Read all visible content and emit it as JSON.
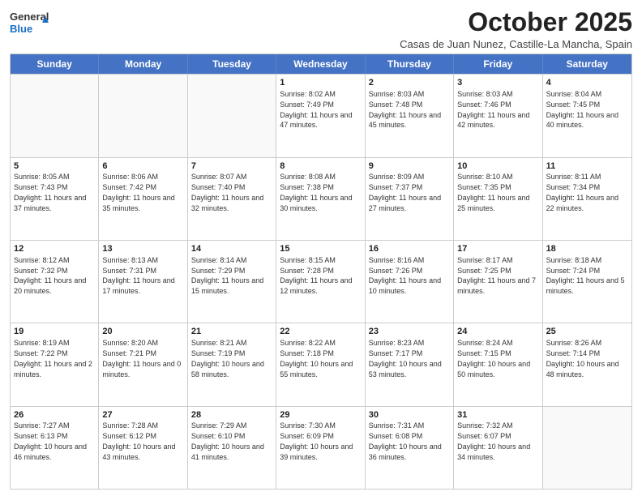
{
  "header": {
    "logo_line1": "General",
    "logo_line2": "Blue",
    "month": "October 2025",
    "location": "Casas de Juan Nunez, Castille-La Mancha, Spain"
  },
  "days_of_week": [
    "Sunday",
    "Monday",
    "Tuesday",
    "Wednesday",
    "Thursday",
    "Friday",
    "Saturday"
  ],
  "weeks": [
    [
      {
        "day": "",
        "info": ""
      },
      {
        "day": "",
        "info": ""
      },
      {
        "day": "",
        "info": ""
      },
      {
        "day": "1",
        "info": "Sunrise: 8:02 AM\nSunset: 7:49 PM\nDaylight: 11 hours and 47 minutes."
      },
      {
        "day": "2",
        "info": "Sunrise: 8:03 AM\nSunset: 7:48 PM\nDaylight: 11 hours and 45 minutes."
      },
      {
        "day": "3",
        "info": "Sunrise: 8:03 AM\nSunset: 7:46 PM\nDaylight: 11 hours and 42 minutes."
      },
      {
        "day": "4",
        "info": "Sunrise: 8:04 AM\nSunset: 7:45 PM\nDaylight: 11 hours and 40 minutes."
      }
    ],
    [
      {
        "day": "5",
        "info": "Sunrise: 8:05 AM\nSunset: 7:43 PM\nDaylight: 11 hours and 37 minutes."
      },
      {
        "day": "6",
        "info": "Sunrise: 8:06 AM\nSunset: 7:42 PM\nDaylight: 11 hours and 35 minutes."
      },
      {
        "day": "7",
        "info": "Sunrise: 8:07 AM\nSunset: 7:40 PM\nDaylight: 11 hours and 32 minutes."
      },
      {
        "day": "8",
        "info": "Sunrise: 8:08 AM\nSunset: 7:38 PM\nDaylight: 11 hours and 30 minutes."
      },
      {
        "day": "9",
        "info": "Sunrise: 8:09 AM\nSunset: 7:37 PM\nDaylight: 11 hours and 27 minutes."
      },
      {
        "day": "10",
        "info": "Sunrise: 8:10 AM\nSunset: 7:35 PM\nDaylight: 11 hours and 25 minutes."
      },
      {
        "day": "11",
        "info": "Sunrise: 8:11 AM\nSunset: 7:34 PM\nDaylight: 11 hours and 22 minutes."
      }
    ],
    [
      {
        "day": "12",
        "info": "Sunrise: 8:12 AM\nSunset: 7:32 PM\nDaylight: 11 hours and 20 minutes."
      },
      {
        "day": "13",
        "info": "Sunrise: 8:13 AM\nSunset: 7:31 PM\nDaylight: 11 hours and 17 minutes."
      },
      {
        "day": "14",
        "info": "Sunrise: 8:14 AM\nSunset: 7:29 PM\nDaylight: 11 hours and 15 minutes."
      },
      {
        "day": "15",
        "info": "Sunrise: 8:15 AM\nSunset: 7:28 PM\nDaylight: 11 hours and 12 minutes."
      },
      {
        "day": "16",
        "info": "Sunrise: 8:16 AM\nSunset: 7:26 PM\nDaylight: 11 hours and 10 minutes."
      },
      {
        "day": "17",
        "info": "Sunrise: 8:17 AM\nSunset: 7:25 PM\nDaylight: 11 hours and 7 minutes."
      },
      {
        "day": "18",
        "info": "Sunrise: 8:18 AM\nSunset: 7:24 PM\nDaylight: 11 hours and 5 minutes."
      }
    ],
    [
      {
        "day": "19",
        "info": "Sunrise: 8:19 AM\nSunset: 7:22 PM\nDaylight: 11 hours and 2 minutes."
      },
      {
        "day": "20",
        "info": "Sunrise: 8:20 AM\nSunset: 7:21 PM\nDaylight: 11 hours and 0 minutes."
      },
      {
        "day": "21",
        "info": "Sunrise: 8:21 AM\nSunset: 7:19 PM\nDaylight: 10 hours and 58 minutes."
      },
      {
        "day": "22",
        "info": "Sunrise: 8:22 AM\nSunset: 7:18 PM\nDaylight: 10 hours and 55 minutes."
      },
      {
        "day": "23",
        "info": "Sunrise: 8:23 AM\nSunset: 7:17 PM\nDaylight: 10 hours and 53 minutes."
      },
      {
        "day": "24",
        "info": "Sunrise: 8:24 AM\nSunset: 7:15 PM\nDaylight: 10 hours and 50 minutes."
      },
      {
        "day": "25",
        "info": "Sunrise: 8:26 AM\nSunset: 7:14 PM\nDaylight: 10 hours and 48 minutes."
      }
    ],
    [
      {
        "day": "26",
        "info": "Sunrise: 7:27 AM\nSunset: 6:13 PM\nDaylight: 10 hours and 46 minutes."
      },
      {
        "day": "27",
        "info": "Sunrise: 7:28 AM\nSunset: 6:12 PM\nDaylight: 10 hours and 43 minutes."
      },
      {
        "day": "28",
        "info": "Sunrise: 7:29 AM\nSunset: 6:10 PM\nDaylight: 10 hours and 41 minutes."
      },
      {
        "day": "29",
        "info": "Sunrise: 7:30 AM\nSunset: 6:09 PM\nDaylight: 10 hours and 39 minutes."
      },
      {
        "day": "30",
        "info": "Sunrise: 7:31 AM\nSunset: 6:08 PM\nDaylight: 10 hours and 36 minutes."
      },
      {
        "day": "31",
        "info": "Sunrise: 7:32 AM\nSunset: 6:07 PM\nDaylight: 10 hours and 34 minutes."
      },
      {
        "day": "",
        "info": ""
      }
    ]
  ]
}
